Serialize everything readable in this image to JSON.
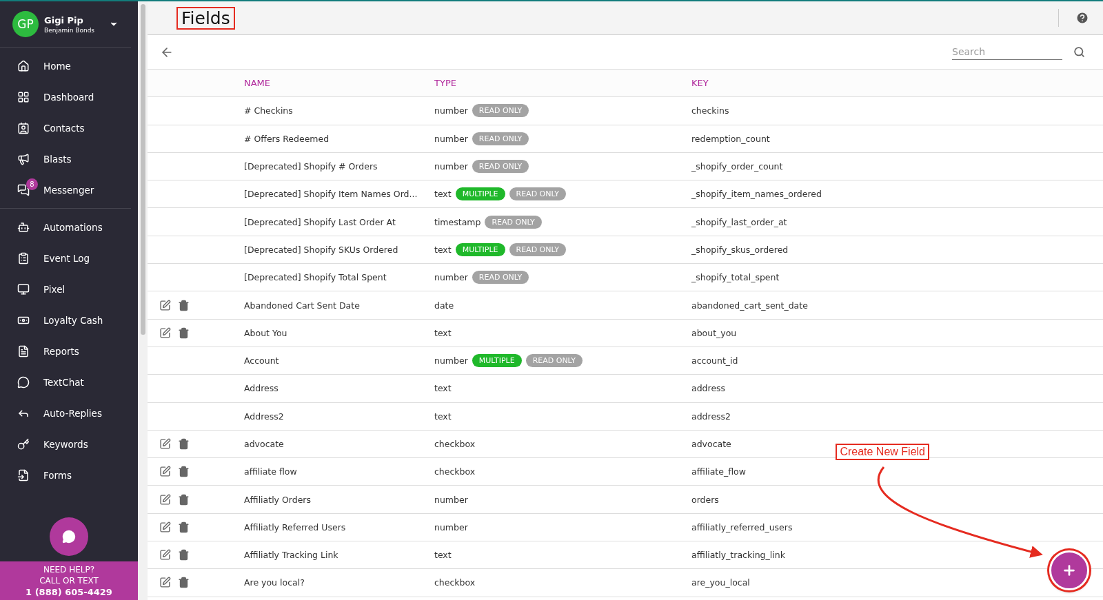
{
  "sidebar": {
    "user": {
      "initials": "GP",
      "name": "Gigi Pip",
      "subtitle": "Benjamin Bonds"
    },
    "groups": [
      [
        {
          "label": "Home"
        },
        {
          "label": "Dashboard"
        },
        {
          "label": "Contacts"
        },
        {
          "label": "Blasts"
        },
        {
          "label": "Messenger",
          "badge": "8"
        }
      ],
      [
        {
          "label": "Automations"
        },
        {
          "label": "Event Log"
        },
        {
          "label": "Pixel"
        },
        {
          "label": "Loyalty Cash"
        },
        {
          "label": "Reports"
        },
        {
          "label": "TextChat"
        },
        {
          "label": "Auto-Replies"
        },
        {
          "label": "Keywords"
        },
        {
          "label": "Forms"
        }
      ]
    ],
    "help": {
      "line1": "NEED HELP?",
      "line2": "CALL OR TEXT",
      "phone": "1 (888) 605-4429"
    }
  },
  "page": {
    "title": "Fields"
  },
  "search": {
    "placeholder": "Search"
  },
  "table": {
    "columns": [
      "NAME",
      "TYPE",
      "KEY"
    ],
    "rows": [
      {
        "editable": false,
        "name": "# Checkins",
        "type": "number",
        "tags": [
          {
            "label": "READ ONLY",
            "kind": "readonly"
          }
        ],
        "key": "checkins"
      },
      {
        "editable": false,
        "name": "# Offers Redeemed",
        "type": "number",
        "tags": [
          {
            "label": "READ ONLY",
            "kind": "readonly"
          }
        ],
        "key": "redemption_count"
      },
      {
        "editable": false,
        "name": "[Deprecated] Shopify # Orders",
        "type": "number",
        "tags": [
          {
            "label": "READ ONLY",
            "kind": "readonly"
          }
        ],
        "key": "_shopify_order_count"
      },
      {
        "editable": false,
        "name": "[Deprecated] Shopify Item Names Ord...",
        "type": "text",
        "tags": [
          {
            "label": "MULTIPLE",
            "kind": "multiple"
          },
          {
            "label": "READ ONLY",
            "kind": "readonly"
          }
        ],
        "key": "_shopify_item_names_ordered"
      },
      {
        "editable": false,
        "name": "[Deprecated] Shopify Last Order At",
        "type": "timestamp",
        "tags": [
          {
            "label": "READ ONLY",
            "kind": "readonly"
          }
        ],
        "key": "_shopify_last_order_at"
      },
      {
        "editable": false,
        "name": "[Deprecated] Shopify SKUs Ordered",
        "type": "text",
        "tags": [
          {
            "label": "MULTIPLE",
            "kind": "multiple"
          },
          {
            "label": "READ ONLY",
            "kind": "readonly"
          }
        ],
        "key": "_shopify_skus_ordered"
      },
      {
        "editable": false,
        "name": "[Deprecated] Shopify Total Spent",
        "type": "number",
        "tags": [
          {
            "label": "READ ONLY",
            "kind": "readonly"
          }
        ],
        "key": "_shopify_total_spent"
      },
      {
        "editable": true,
        "name": "Abandoned Cart Sent Date",
        "type": "date",
        "tags": [],
        "key": "abandoned_cart_sent_date"
      },
      {
        "editable": true,
        "name": "About You",
        "type": "text",
        "tags": [],
        "key": "about_you"
      },
      {
        "editable": false,
        "name": "Account",
        "type": "number",
        "tags": [
          {
            "label": "MULTIPLE",
            "kind": "multiple"
          },
          {
            "label": "READ ONLY",
            "kind": "readonly"
          }
        ],
        "key": "account_id"
      },
      {
        "editable": false,
        "name": "Address",
        "type": "text",
        "tags": [],
        "key": "address"
      },
      {
        "editable": false,
        "name": "Address2",
        "type": "text",
        "tags": [],
        "key": "address2"
      },
      {
        "editable": true,
        "name": "advocate",
        "type": "checkbox",
        "tags": [],
        "key": "advocate"
      },
      {
        "editable": true,
        "name": "affiliate flow",
        "type": "checkbox",
        "tags": [],
        "key": "affiliate_flow"
      },
      {
        "editable": true,
        "name": "Affiliatly Orders",
        "type": "number",
        "tags": [],
        "key": "orders"
      },
      {
        "editable": true,
        "name": "Affiliatly Referred Users",
        "type": "number",
        "tags": [],
        "key": "affiliatly_referred_users"
      },
      {
        "editable": true,
        "name": "Affiliatly Tracking Link",
        "type": "text",
        "tags": [],
        "key": "affiliatly_tracking_link"
      },
      {
        "editable": true,
        "name": "Are you local?",
        "type": "checkbox",
        "tags": [],
        "key": "are_you_local"
      }
    ]
  },
  "annotation": {
    "label": "Create New Field"
  }
}
